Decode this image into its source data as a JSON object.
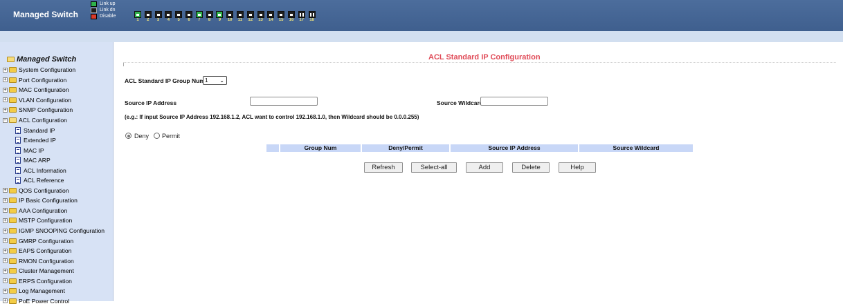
{
  "header": {
    "brand": "Managed Switch",
    "legend": [
      {
        "label": "Link up",
        "color": "#2fb24a"
      },
      {
        "label": "Link dn",
        "color": "#1d1d1d"
      },
      {
        "label": "Disable",
        "color": "#d93a2b"
      }
    ],
    "ports": [
      {
        "num": "1",
        "state": "up",
        "type": "rj45"
      },
      {
        "num": "2",
        "state": "down",
        "type": "rj45"
      },
      {
        "num": "3",
        "state": "down",
        "type": "rj45"
      },
      {
        "num": "4",
        "state": "down",
        "type": "rj45"
      },
      {
        "num": "5",
        "state": "down",
        "type": "rj45"
      },
      {
        "num": "6",
        "state": "down",
        "type": "rj45"
      },
      {
        "num": "7",
        "state": "up",
        "type": "rj45"
      },
      {
        "num": "8",
        "state": "down",
        "type": "rj45"
      },
      {
        "num": "9",
        "state": "up",
        "type": "rj45"
      },
      {
        "num": "10",
        "state": "down",
        "type": "rj45"
      },
      {
        "num": "11",
        "state": "down",
        "type": "rj45"
      },
      {
        "num": "12",
        "state": "down",
        "type": "rj45"
      },
      {
        "num": "13",
        "state": "down",
        "type": "rj45"
      },
      {
        "num": "14",
        "state": "down",
        "type": "rj45"
      },
      {
        "num": "15",
        "state": "down",
        "type": "rj45"
      },
      {
        "num": "16",
        "state": "down",
        "type": "rj45"
      },
      {
        "num": "17",
        "state": "down",
        "type": "sfp"
      },
      {
        "num": "18",
        "state": "down",
        "type": "sfp"
      }
    ]
  },
  "sidebar": {
    "title": "Managed Switch",
    "items": [
      {
        "label": "System Configuration",
        "level": 0,
        "kind": "folder",
        "expanded": false
      },
      {
        "label": "Port Configuration",
        "level": 0,
        "kind": "folder",
        "expanded": false
      },
      {
        "label": "MAC Configuration",
        "level": 0,
        "kind": "folder",
        "expanded": false
      },
      {
        "label": "VLAN Configuration",
        "level": 0,
        "kind": "folder",
        "expanded": false
      },
      {
        "label": "SNMP Configuration",
        "level": 0,
        "kind": "folder",
        "expanded": false
      },
      {
        "label": "ACL Configuration",
        "level": 0,
        "kind": "folder",
        "expanded": true
      },
      {
        "label": "Standard IP",
        "level": 1,
        "kind": "page"
      },
      {
        "label": "Extended IP",
        "level": 1,
        "kind": "page"
      },
      {
        "label": "MAC IP",
        "level": 1,
        "kind": "page"
      },
      {
        "label": "MAC ARP",
        "level": 1,
        "kind": "page"
      },
      {
        "label": "ACL Information",
        "level": 1,
        "kind": "page"
      },
      {
        "label": "ACL Reference",
        "level": 1,
        "kind": "page"
      },
      {
        "label": "QOS Configuration",
        "level": 0,
        "kind": "folder",
        "expanded": false
      },
      {
        "label": "IP Basic Configuration",
        "level": 0,
        "kind": "folder",
        "expanded": false
      },
      {
        "label": "AAA Configuration",
        "level": 0,
        "kind": "folder",
        "expanded": false
      },
      {
        "label": "MSTP Configuration",
        "level": 0,
        "kind": "folder",
        "expanded": false
      },
      {
        "label": "IGMP SNOOPING Configuration",
        "level": 0,
        "kind": "folder",
        "expanded": false
      },
      {
        "label": "GMRP Configuration",
        "level": 0,
        "kind": "folder",
        "expanded": false
      },
      {
        "label": "EAPS Configuration",
        "level": 0,
        "kind": "folder",
        "expanded": false
      },
      {
        "label": "RMON Configuration",
        "level": 0,
        "kind": "folder",
        "expanded": false
      },
      {
        "label": "Cluster Management",
        "level": 0,
        "kind": "folder",
        "expanded": false
      },
      {
        "label": "ERPS Configuration",
        "level": 0,
        "kind": "folder",
        "expanded": false
      },
      {
        "label": "Log Management",
        "level": 0,
        "kind": "folder",
        "expanded": false
      },
      {
        "label": "PoE Power Control",
        "level": 0,
        "kind": "folder",
        "expanded": false
      }
    ]
  },
  "main": {
    "title": "ACL Standard IP Configuration",
    "group_num_label": "ACL Standard IP Group Num:",
    "group_num_value": "1",
    "source_ip_label": "Source IP Address",
    "source_ip_value": "",
    "source_wildcard_label": "Source Wildcard",
    "source_wildcard_value": "",
    "hint": "(e.g.: If input Source IP Address 192.168.1.2, ACL want to control 192.168.1.0, then Wildcard should be 0.0.0.255)",
    "action_options": [
      {
        "label": "Deny",
        "selected": true
      },
      {
        "label": "Permit",
        "selected": false
      }
    ],
    "table_headers": [
      "",
      "Group Num",
      "Deny/Permit",
      "Source IP Address",
      "Source Wildcard"
    ],
    "buttons": [
      "Refresh",
      "Select-all",
      "Add",
      "Delete",
      "Help"
    ]
  }
}
